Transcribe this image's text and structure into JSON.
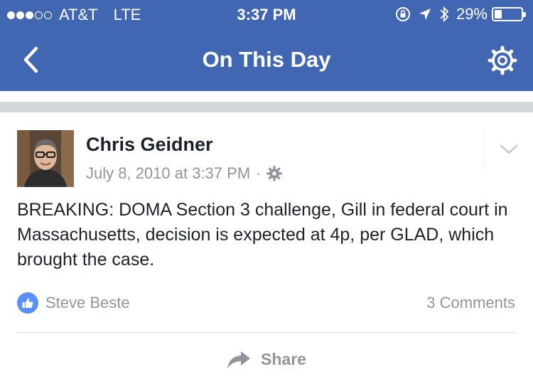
{
  "status_bar": {
    "signal_full": 3,
    "signal_empty": 2,
    "carrier": "AT&T",
    "network": "LTE",
    "time": "3:37 PM",
    "battery_text": "29%",
    "battery_level": 0.29,
    "icons": [
      "rotation-lock-icon",
      "location-arrow-icon",
      "bluetooth-icon",
      "battery-icon"
    ]
  },
  "nav": {
    "title": "On This Day",
    "back_icon": "chevron-left-icon",
    "settings_icon": "gear-icon"
  },
  "post": {
    "author": "Chris Geidner",
    "date": "July 8, 2010 at 3:37 PM",
    "separator": "·",
    "privacy_icon": "gear-icon",
    "menu_icon": "chevron-down-icon",
    "text": "BREAKING: DOMA Section 3 challenge, Gill in federal court in Massachusetts, decision is expected at 4p, per GLAD, which brought the case.",
    "reactions": {
      "icon": "like-icon",
      "name": "Steve Beste"
    },
    "comments": "3 Comments",
    "share_label": "Share"
  },
  "colors": {
    "header": "#4267b2",
    "like_badge": "#5890ff",
    "meta_text": "#90949c",
    "divider_band": "#d3d6db"
  }
}
